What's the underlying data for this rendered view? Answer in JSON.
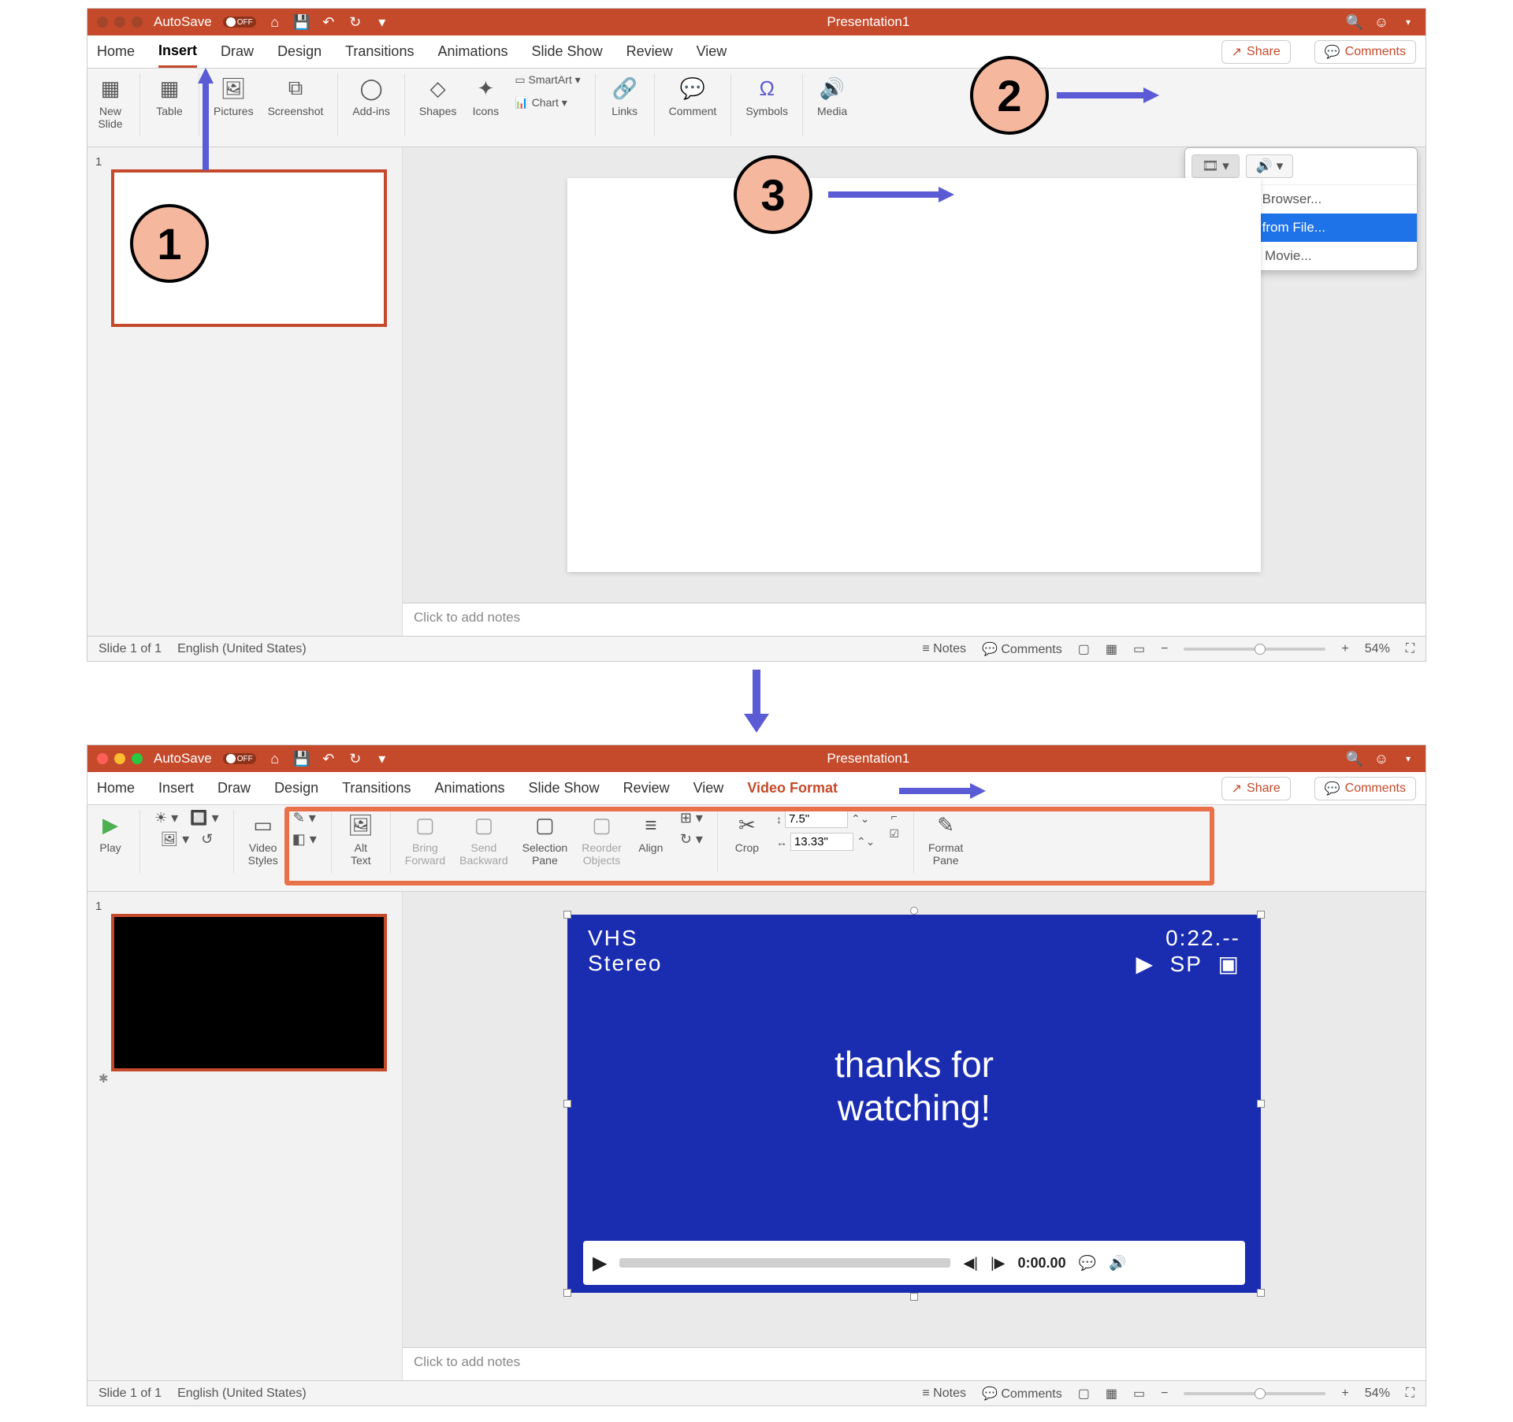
{
  "shot1": {
    "title": "Presentation1",
    "autosave_label": "AutoSave",
    "autosave_state": "OFF",
    "tabs": [
      "Home",
      "Insert",
      "Draw",
      "Design",
      "Transitions",
      "Animations",
      "Slide Show",
      "Review",
      "View"
    ],
    "active_tab": "Insert",
    "share": "Share",
    "comments": "Comments",
    "ribbon": {
      "new_slide": "New\nSlide",
      "table": "Table",
      "pictures": "Pictures",
      "screenshot": "Screenshot",
      "addins": "Add-ins",
      "shapes": "Shapes",
      "icons": "Icons",
      "smartart": "SmartArt",
      "chart": "Chart",
      "links": "Links",
      "comment": "Comment",
      "symbols": "Symbols",
      "media": "Media"
    },
    "media_menu": {
      "browser": "Movie Browser...",
      "from_file": "Movie from File...",
      "online": "Online Movie..."
    },
    "notes_placeholder": "Click to add notes",
    "status": {
      "slide": "Slide 1 of 1",
      "lang": "English (United States)",
      "notes": "Notes",
      "comments": "Comments",
      "zoom": "54%"
    },
    "annotations": {
      "step1": "1",
      "step2": "2",
      "step3": "3"
    }
  },
  "shot2": {
    "title": "Presentation1",
    "autosave_label": "AutoSave",
    "autosave_state": "OFF",
    "tabs": [
      "Home",
      "Insert",
      "Draw",
      "Design",
      "Transitions",
      "Animations",
      "Slide Show",
      "Review",
      "View",
      "Video Format"
    ],
    "share": "Share",
    "comments": "Comments",
    "ribbon": {
      "play": "Play",
      "video_styles": "Video\nStyles",
      "alt_text": "Alt\nText",
      "bring_forward": "Bring\nForward",
      "send_backward": "Send\nBackward",
      "selection_pane": "Selection\nPane",
      "reorder_objects": "Reorder\nObjects",
      "align": "Align",
      "crop": "Crop",
      "height": "7.5\"",
      "width": "13.33\"",
      "format_pane": "Format\nPane"
    },
    "video": {
      "vhs": "VHS",
      "stereo": "Stereo",
      "time": "0:22.--",
      "sp": "SP",
      "play_icon": "▶",
      "caption_icon": "▣",
      "msg_line1": "thanks for",
      "msg_line2": "watching!",
      "playtime": "0:00.00"
    },
    "notes_placeholder": "Click to add notes",
    "status": {
      "slide": "Slide 1 of 1",
      "lang": "English (United States)",
      "notes": "Notes",
      "comments": "Comments",
      "zoom": "54%"
    }
  }
}
